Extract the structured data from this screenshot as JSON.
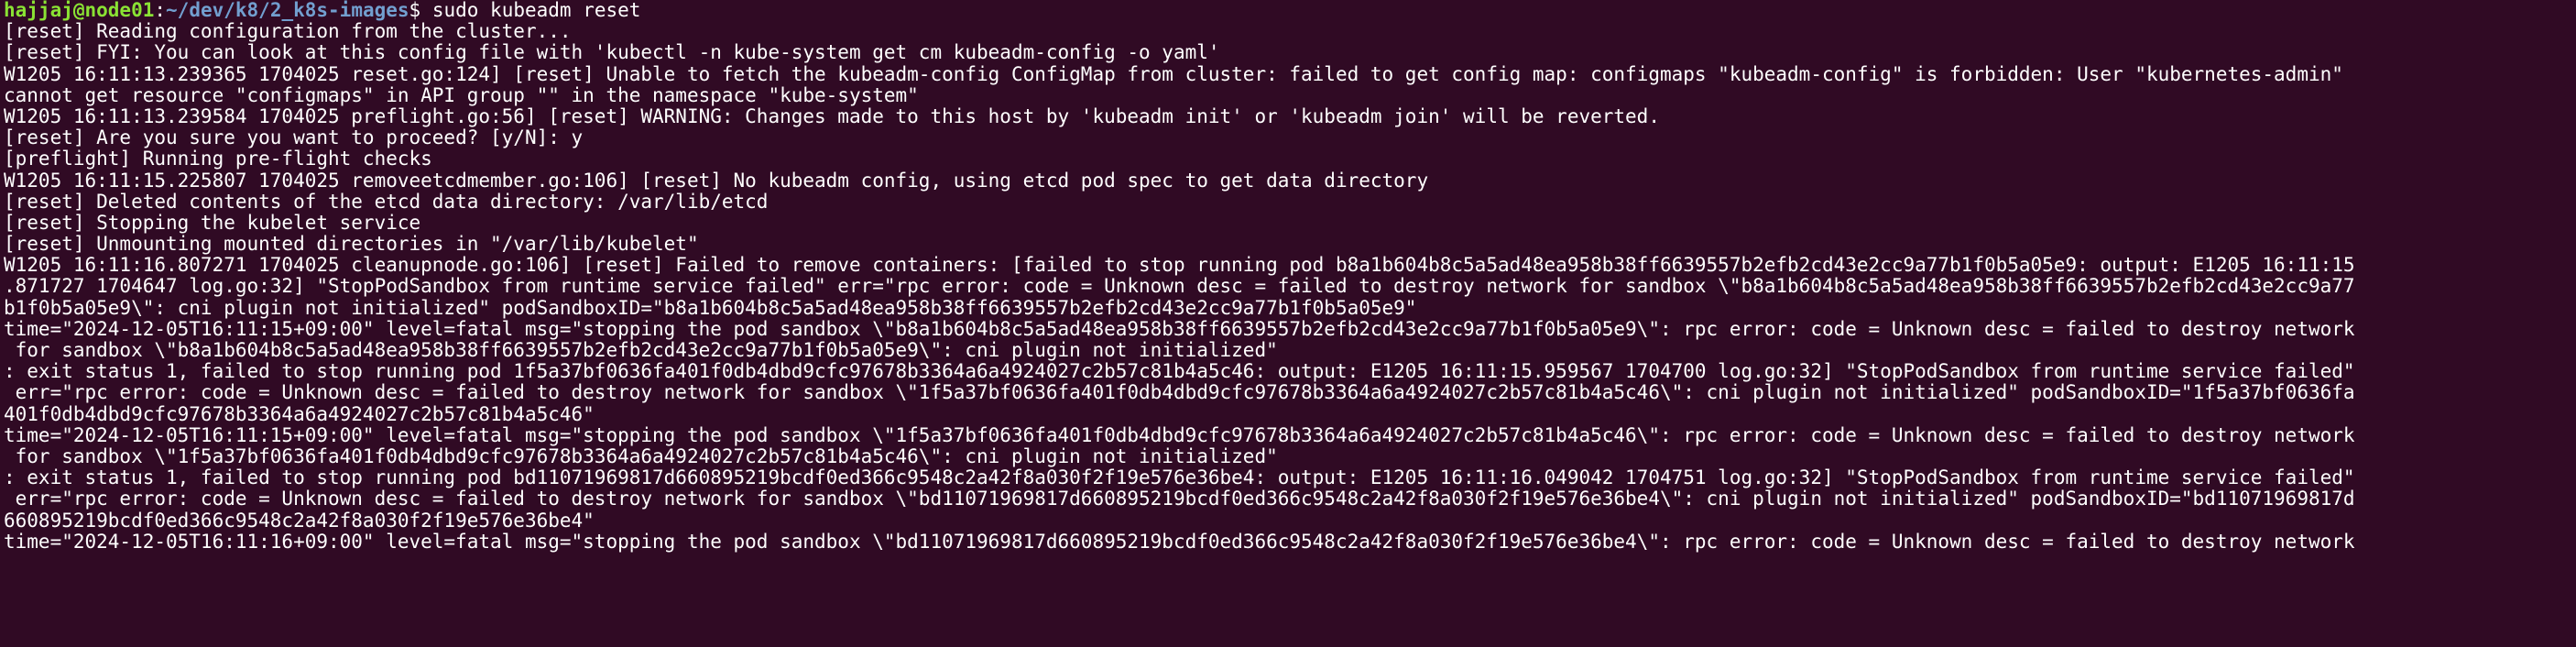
{
  "prompt": {
    "user_host": "hajjaj@node01",
    "separator": ":",
    "path": "~/dev/k8/2_k8s-images",
    "symbol": "$ ",
    "command": "sudo kubeadm reset"
  },
  "output_lines": [
    "[reset] Reading configuration from the cluster...",
    "[reset] FYI: You can look at this config file with 'kubectl -n kube-system get cm kubeadm-config -o yaml'",
    "W1205 16:11:13.239365 1704025 reset.go:124] [reset] Unable to fetch the kubeadm-config ConfigMap from cluster: failed to get config map: configmaps \"kubeadm-config\" is forbidden: User \"kubernetes-admin\"",
    "cannot get resource \"configmaps\" in API group \"\" in the namespace \"kube-system\"",
    "W1205 16:11:13.239584 1704025 preflight.go:56] [reset] WARNING: Changes made to this host by 'kubeadm init' or 'kubeadm join' will be reverted.",
    "[reset] Are you sure you want to proceed? [y/N]: y",
    "[preflight] Running pre-flight checks",
    "W1205 16:11:15.225807 1704025 removeetcdmember.go:106] [reset] No kubeadm config, using etcd pod spec to get data directory",
    "[reset] Deleted contents of the etcd data directory: /var/lib/etcd",
    "[reset] Stopping the kubelet service",
    "[reset] Unmounting mounted directories in \"/var/lib/kubelet\"",
    "W1205 16:11:16.807271 1704025 cleanupnode.go:106] [reset] Failed to remove containers: [failed to stop running pod b8a1b604b8c5a5ad48ea958b38ff6639557b2efb2cd43e2cc9a77b1f0b5a05e9: output: E1205 16:11:15",
    ".871727 1704647 log.go:32] \"StopPodSandbox from runtime service failed\" err=\"rpc error: code = Unknown desc = failed to destroy network for sandbox \\\"b8a1b604b8c5a5ad48ea958b38ff6639557b2efb2cd43e2cc9a77",
    "b1f0b5a05e9\\\": cni plugin not initialized\" podSandboxID=\"b8a1b604b8c5a5ad48ea958b38ff6639557b2efb2cd43e2cc9a77b1f0b5a05e9\"",
    "time=\"2024-12-05T16:11:15+09:00\" level=fatal msg=\"stopping the pod sandbox \\\"b8a1b604b8c5a5ad48ea958b38ff6639557b2efb2cd43e2cc9a77b1f0b5a05e9\\\": rpc error: code = Unknown desc = failed to destroy network",
    " for sandbox \\\"b8a1b604b8c5a5ad48ea958b38ff6639557b2efb2cd43e2cc9a77b1f0b5a05e9\\\": cni plugin not initialized\"",
    ": exit status 1, failed to stop running pod 1f5a37bf0636fa401f0db4dbd9cfc97678b3364a6a4924027c2b57c81b4a5c46: output: E1205 16:11:15.959567 1704700 log.go:32] \"StopPodSandbox from runtime service failed\"",
    " err=\"rpc error: code = Unknown desc = failed to destroy network for sandbox \\\"1f5a37bf0636fa401f0db4dbd9cfc97678b3364a6a4924027c2b57c81b4a5c46\\\": cni plugin not initialized\" podSandboxID=\"1f5a37bf0636fa",
    "401f0db4dbd9cfc97678b3364a6a4924027c2b57c81b4a5c46\"",
    "time=\"2024-12-05T16:11:15+09:00\" level=fatal msg=\"stopping the pod sandbox \\\"1f5a37bf0636fa401f0db4dbd9cfc97678b3364a6a4924027c2b57c81b4a5c46\\\": rpc error: code = Unknown desc = failed to destroy network",
    " for sandbox \\\"1f5a37bf0636fa401f0db4dbd9cfc97678b3364a6a4924027c2b57c81b4a5c46\\\": cni plugin not initialized\"",
    ": exit status 1, failed to stop running pod bd11071969817d660895219bcdf0ed366c9548c2a42f8a030f2f19e576e36be4: output: E1205 16:11:16.049042 1704751 log.go:32] \"StopPodSandbox from runtime service failed\"",
    " err=\"rpc error: code = Unknown desc = failed to destroy network for sandbox \\\"bd11071969817d660895219bcdf0ed366c9548c2a42f8a030f2f19e576e36be4\\\": cni plugin not initialized\" podSandboxID=\"bd11071969817d",
    "660895219bcdf0ed366c9548c2a42f8a030f2f19e576e36be4\"",
    "time=\"2024-12-05T16:11:16+09:00\" level=fatal msg=\"stopping the pod sandbox \\\"bd11071969817d660895219bcdf0ed366c9548c2a42f8a030f2f19e576e36be4\\\": rpc error: code = Unknown desc = failed to destroy network"
  ],
  "colors": {
    "background": "#300a24",
    "text": "#ffffff",
    "prompt_user": "#8ae234",
    "prompt_path": "#729fcf"
  }
}
